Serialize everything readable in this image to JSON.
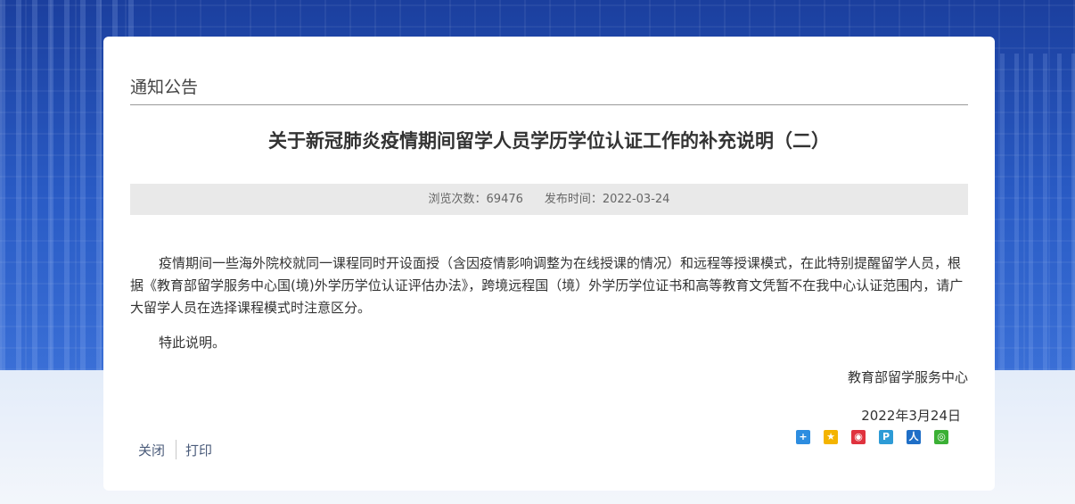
{
  "section": {
    "title": "通知公告"
  },
  "article": {
    "title": "关于新冠肺炎疫情期间留学人员学历学位认证工作的补充说明（二）",
    "views_text": "浏览次数：69476",
    "publish_text": "发布时间：2022-03-24",
    "paragraphs": [
      "疫情期间一些海外院校就同一课程同时开设面授（含因疫情影响调整为在线授课的情况）和远程等授课模式，在此特别提醒留学人员，根据《教育部留学服务中心国(境)外学历学位认证评估办法》，跨境远程国（境）外学历学位证书和高等教育文凭暂不在我中心认证范围内，请广大留学人员在选择课程模式时注意区分。",
      "特此说明。"
    ],
    "signature": "教育部留学服务中心",
    "date": "2022年3月24日"
  },
  "actions": {
    "close_label": "关闭",
    "print_label": "打印"
  },
  "share_icons": [
    {
      "name": "share-more-icon",
      "color": "#2d8de0",
      "glyph": "+"
    },
    {
      "name": "qzone-icon",
      "color": "#f4b400",
      "glyph": "★"
    },
    {
      "name": "weibo-icon",
      "color": "#e0323e",
      "glyph": "◉"
    },
    {
      "name": "tencent-weibo-icon",
      "color": "#2d9bd6",
      "glyph": "P"
    },
    {
      "name": "renren-icon",
      "color": "#1f6fc7",
      "glyph": "人"
    },
    {
      "name": "wechat-icon",
      "color": "#3bb035",
      "glyph": "◎"
    }
  ]
}
